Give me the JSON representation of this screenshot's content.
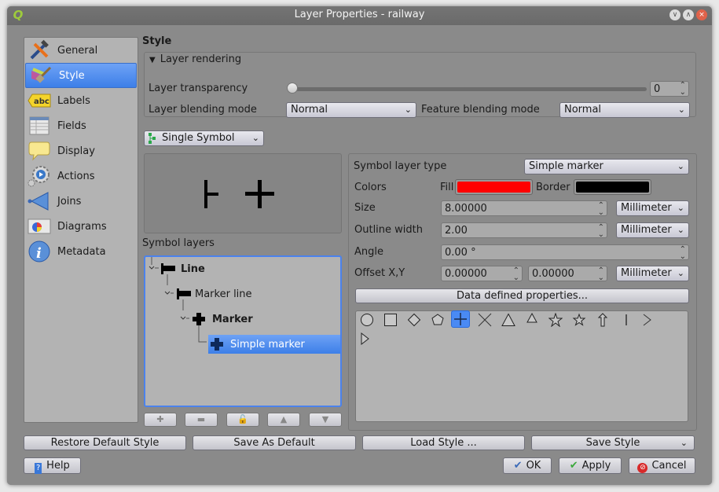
{
  "window": {
    "title": "Layer Properties - railway",
    "app_icon": "qgis-icon",
    "controls": [
      "minimize",
      "maximize",
      "close"
    ]
  },
  "sidebar": {
    "items": [
      {
        "label": "General",
        "icon": "tools-icon"
      },
      {
        "label": "Style",
        "icon": "paintbrush-icon",
        "active": true
      },
      {
        "label": "Labels",
        "icon": "abc-label-icon"
      },
      {
        "label": "Fields",
        "icon": "table-icon"
      },
      {
        "label": "Display",
        "icon": "speech-bubble-icon"
      },
      {
        "label": "Actions",
        "icon": "gear-play-icon"
      },
      {
        "label": "Joins",
        "icon": "join-arrow-icon"
      },
      {
        "label": "Diagrams",
        "icon": "pie-map-icon"
      },
      {
        "label": "Metadata",
        "icon": "info-icon"
      }
    ]
  },
  "style": {
    "section_title": "Style",
    "layer_rendering": {
      "title": "Layer rendering",
      "transparency_label": "Layer transparency",
      "transparency_value": "0",
      "transparency_fraction": 0,
      "blending_label": "Layer blending mode",
      "blending_value": "Normal",
      "feature_blending_label": "Feature blending mode",
      "feature_blending_value": "Normal"
    },
    "renderer": "Single Symbol",
    "symbol_layers_label": "Symbol layers",
    "tree": [
      {
        "label": "Line",
        "bold": true,
        "icon": "line-symbol-icon"
      },
      {
        "label": "Marker line",
        "bold": false,
        "icon": "line-symbol-icon"
      },
      {
        "label": "Marker",
        "bold": true,
        "icon": "cross-marker-icon"
      },
      {
        "label": "Simple marker",
        "bold": false,
        "icon": "cross-marker-icon",
        "selected": true
      }
    ],
    "tree_buttons": [
      "add-layer",
      "remove-layer",
      "lock-layer",
      "move-up",
      "move-down"
    ],
    "props": {
      "symbol_layer_type_label": "Symbol layer type",
      "symbol_layer_type": "Simple marker",
      "colors_label": "Colors",
      "fill_label": "Fill",
      "fill_color": "#ff0000",
      "border_label": "Border",
      "border_color": "#000000",
      "size_label": "Size",
      "size_value": "8.00000",
      "size_unit": "Millimeter",
      "outline_label": "Outline width",
      "outline_value": "2.00",
      "outline_unit": "Millimeter",
      "angle_label": "Angle",
      "angle_value": "0.00 °",
      "offset_label": "Offset X,Y",
      "offset_x": "0.00000",
      "offset_y": "0.00000",
      "offset_unit": "Millimeter",
      "data_defined_label": "Data defined properties..."
    },
    "shapes": [
      "circle",
      "square",
      "diamond",
      "pentagon",
      "cross",
      "x",
      "triangle",
      "equilateral-triangle",
      "star",
      "regular-star",
      "arrow",
      "line",
      "arrowhead",
      "filled-arrowhead"
    ],
    "selected_shape": "cross"
  },
  "footer": {
    "restore_default": "Restore Default Style",
    "save_as_default": "Save As Default",
    "load_style": "Load Style ...",
    "save_style": "Save Style",
    "help": "Help",
    "ok": "OK",
    "apply": "Apply",
    "cancel": "Cancel"
  }
}
